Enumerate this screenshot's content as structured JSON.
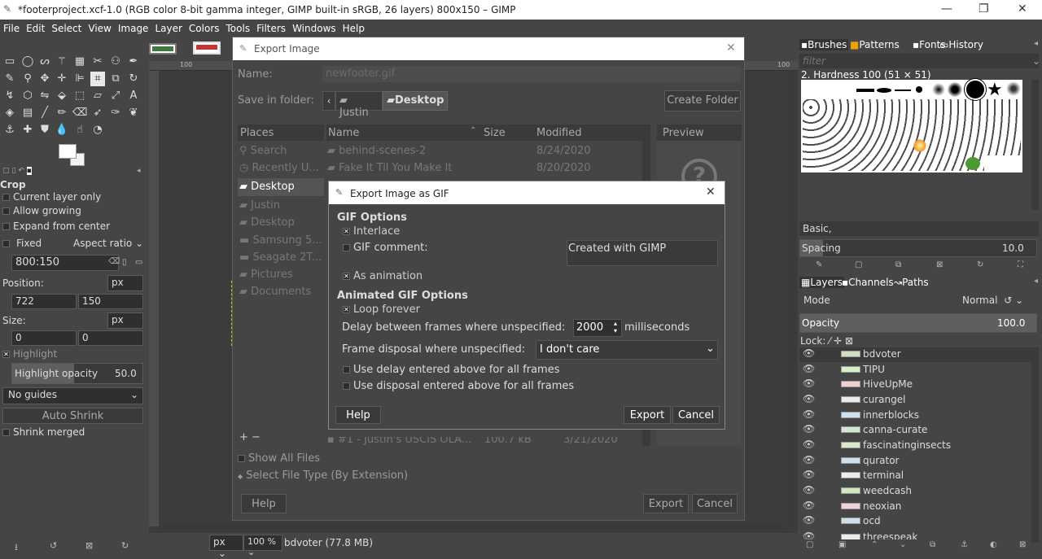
{
  "window": {
    "title": "*footerproject.xcf-1.0 (RGB color 8-bit gamma integer, GIMP built-in sRGB, 26 layers) 800x150 – GIMP"
  },
  "menu": [
    "File",
    "Edit",
    "Select",
    "View",
    "Image",
    "Layer",
    "Colors",
    "Tools",
    "Filters",
    "Windows",
    "Help"
  ],
  "tool_options": {
    "title": "Crop",
    "current_layer_only": "Current layer only",
    "allow_growing": "Allow growing",
    "expand_from_center": "Expand from center",
    "fixed": "Fixed",
    "aspect": "Aspect ratio",
    "ratio": "800:150",
    "position_label": "Position:",
    "pos_unit": "px",
    "pos_x": "722",
    "pos_y": "150",
    "size_label": "Size:",
    "size_unit": "px",
    "size_w": "0",
    "size_h": "0",
    "highlight": "Highlight",
    "highlight_opacity_label": "Highlight opacity",
    "highlight_opacity": "50.0",
    "guides": "No guides",
    "auto_shrink": "Auto Shrink",
    "shrink_merged": "Shrink merged"
  },
  "ruler": {
    "r100a": "100",
    "r100b": "100"
  },
  "export_dialog": {
    "title": "Export Image",
    "name_label": "Name:",
    "name_value": "newfooter.gif",
    "save_in_label": "Save in folder:",
    "crumbs": [
      "Justin",
      "Desktop"
    ],
    "create_folder": "Create Folder",
    "places_header": "Places",
    "places": [
      "Search",
      "Recently U...",
      "Desktop",
      "Justin",
      "Desktop",
      "Samsung 5...",
      "Seagate 2T...",
      "Pictures",
      "Documents"
    ],
    "col_name": "Name",
    "col_size": "Size",
    "col_modified": "Modified",
    "preview": "Preview",
    "files": [
      {
        "name": "behind-scenes-2",
        "mod": "8/24/2020"
      },
      {
        "name": "Fake It Til You Make It",
        "mod": "8/20/2020"
      }
    ],
    "bottom_file": {
      "name": "#1 - Justin's USCIS OLA...",
      "size": "100.7 kB",
      "mod": "3/21/2020"
    },
    "show_all": "Show All Files",
    "select_type": "Select File Type (By Extension)",
    "help": "Help",
    "export": "Export",
    "cancel": "Cancel",
    "add_remove": "+  −"
  },
  "gif_dialog": {
    "title": "Export Image as GIF",
    "section1": "GIF Options",
    "interlace": "Interlace",
    "comment_label": "GIF comment:",
    "comment_value": "Created with GIMP",
    "as_animation": "As animation",
    "section2": "Animated GIF Options",
    "loop_forever": "Loop forever",
    "delay_label": "Delay between frames where unspecified:",
    "delay_value": "2000",
    "delay_unit": "milliseconds",
    "disposal_label": "Frame disposal where unspecified:",
    "disposal_value": "I don't care",
    "use_delay": "Use delay entered above for all frames",
    "use_disposal": "Use disposal entered above for all frames",
    "help": "Help",
    "export": "Export",
    "cancel": "Cancel"
  },
  "brushes_dock": {
    "tabs": [
      "Brushes",
      "Patterns",
      "Fonts",
      "History"
    ],
    "filter_placeholder": "filter",
    "brush_name": "2. Hardness 100 (51 × 51)",
    "preset": "Basic,",
    "spacing_label": "Spacing",
    "spacing_value": "10.0"
  },
  "layers_dock": {
    "tabs": [
      "Layers",
      "Channels",
      "Paths"
    ],
    "mode_label": "Mode",
    "mode_value": "Normal",
    "opacity_label": "Opacity",
    "opacity_value": "100.0",
    "lock_label": "Lock:",
    "layers": [
      "bdvoter",
      "TIPU",
      "HiveUpMe",
      "curangel",
      "innerblocks",
      "canna-curate",
      "fascinatinginsects",
      "qurator",
      "terminal",
      "weedcash",
      "neoxian",
      "ocd",
      "threespeak"
    ]
  },
  "status": {
    "unit": "px",
    "zoom": "100 %",
    "info": "bdvoter (77.8 MB)"
  }
}
